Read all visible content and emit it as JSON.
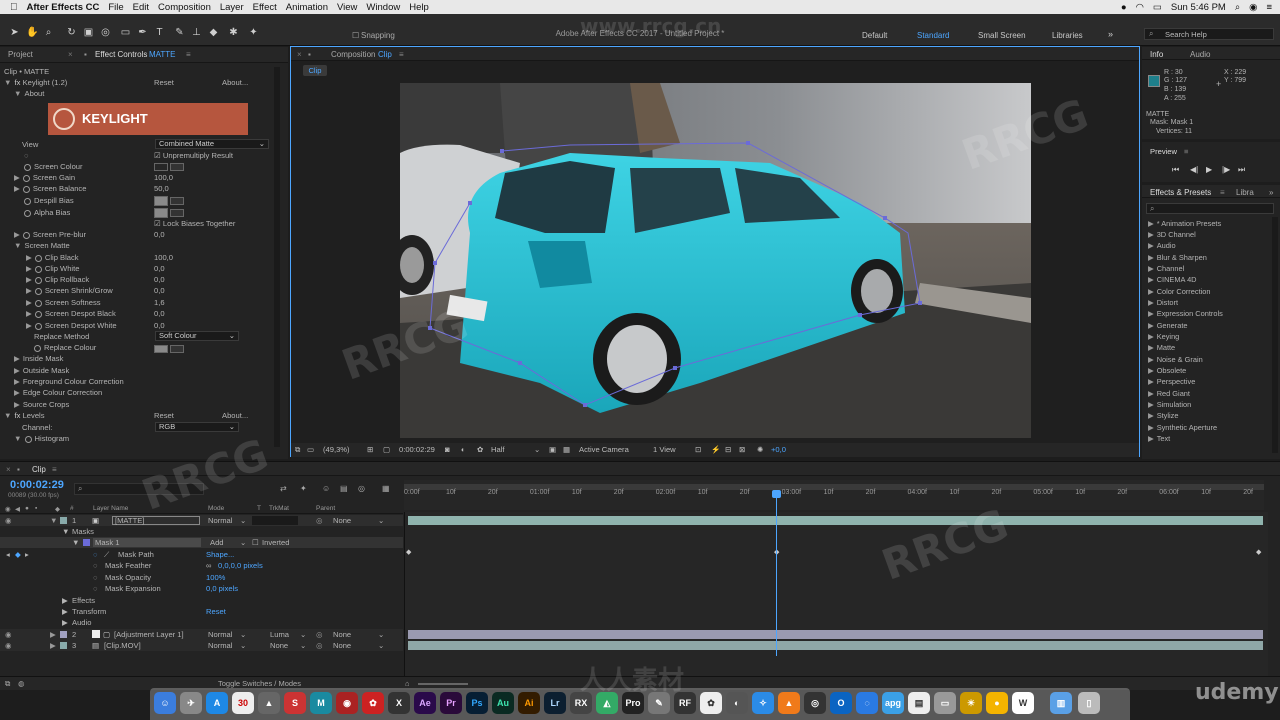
{
  "menubar": {
    "app": "After Effects CC",
    "items": [
      "File",
      "Edit",
      "Composition",
      "Layer",
      "Effect",
      "Animation",
      "View",
      "Window",
      "Help"
    ],
    "time": "Sun 5:46 PM"
  },
  "window_title": "Adobe After Effects CC 2017 - Untitled Project *",
  "toolbar": {
    "snapping": "Snapping",
    "workspaces": [
      "Default",
      "Standard",
      "Small Screen",
      "Libraries"
    ],
    "active_workspace": "Standard",
    "search_placeholder": "Search Help"
  },
  "effect_controls": {
    "tab_project": "Project",
    "tab_label": "Effect Controls",
    "tab_layer": "MATTE",
    "breadcrumb": "Clip • MATTE",
    "effect1": {
      "name": "Keylight (1.2)",
      "reset": "Reset",
      "about": "About..."
    },
    "about": "About",
    "logo_text": "KEYLIGHT",
    "view_label": "View",
    "view_value": "Combined Matte",
    "unpremultiply": "Unpremultiply Result",
    "screen_colour": "Screen Colour",
    "screen_gain": {
      "label": "Screen Gain",
      "value": "100,0"
    },
    "screen_balance": {
      "label": "Screen Balance",
      "value": "50,0"
    },
    "despill_bias": "Despill Bias",
    "alpha_bias": "Alpha Bias",
    "lock_biases": "Lock Biases Together",
    "screen_preblur": {
      "label": "Screen Pre-blur",
      "value": "0,0"
    },
    "screen_matte": "Screen Matte",
    "clip_black": {
      "label": "Clip Black",
      "value": "100,0"
    },
    "clip_white": {
      "label": "Clip White",
      "value": "0,0"
    },
    "clip_rollback": {
      "label": "Clip Rollback",
      "value": "0,0"
    },
    "shrink_grow": {
      "label": "Screen Shrink/Grow",
      "value": "0,0"
    },
    "softness": {
      "label": "Screen Softness",
      "value": "1,6"
    },
    "despot_black": {
      "label": "Screen Despot Black",
      "value": "0,0"
    },
    "despot_white": {
      "label": "Screen Despot White",
      "value": "0,0"
    },
    "replace_method": {
      "label": "Replace Method",
      "value": "Soft Colour"
    },
    "replace_colour": "Replace Colour",
    "inside_mask": "Inside Mask",
    "outside_mask": "Outside Mask",
    "fg_correction": "Foreground Colour Correction",
    "edge_correction": "Edge Colour Correction",
    "source_crops": "Source Crops",
    "effect2": {
      "name": "Levels",
      "reset": "Reset",
      "about": "About..."
    },
    "channel": {
      "label": "Channel:",
      "value": "RGB"
    },
    "histogram": "Histogram"
  },
  "composition": {
    "tab": "Composition",
    "tab_comp": "Clip",
    "subtab": "Clip",
    "zoom": "(49,3%)",
    "timecode": "0:00:02:29",
    "resolution": "Half",
    "camera": "Active Camera",
    "views": "1 View",
    "exposure": "+0,0"
  },
  "info": {
    "tab_info": "Info",
    "tab_audio": "Audio",
    "r": "R : 30",
    "g": "G : 127",
    "b": "B : 139",
    "a": "A : 255",
    "x": "X : 229",
    "y": "Y : 799",
    "layer": "MATTE",
    "mask": "Mask: Mask 1",
    "vertices": "Vertices: 11",
    "swatch_color": "#1e7f8b"
  },
  "preview": {
    "title": "Preview"
  },
  "effects_presets": {
    "tab": "Effects & Presets",
    "tab2": "Libra",
    "items": [
      "* Animation Presets",
      "3D Channel",
      "Audio",
      "Blur & Sharpen",
      "Channel",
      "CINEMA 4D",
      "Color Correction",
      "Distort",
      "Expression Controls",
      "Generate",
      "Keying",
      "Matte",
      "Noise & Grain",
      "Obsolete",
      "Perspective",
      "Red Giant",
      "Simulation",
      "Stylize",
      "Synthetic Aperture",
      "Text"
    ]
  },
  "timeline": {
    "tab": "Clip",
    "timecode": "0:00:02:29",
    "frames": "00089 (30.00 fps)",
    "col_layer_name": "Layer Name",
    "col_mode": "Mode",
    "col_t": "T",
    "col_trkmat": "TrkMat",
    "col_parent": "Parent",
    "ruler": [
      "0:00f",
      "10f",
      "20f",
      "01:00f",
      "10f",
      "20f",
      "02:00f",
      "10f",
      "20f",
      "03:00f",
      "10f",
      "20f",
      "04:00f",
      "10f",
      "20f",
      "05:00f",
      "10f",
      "20f",
      "06:00f",
      "10f",
      "20f"
    ],
    "layer1": {
      "num": "1",
      "name": "[MATTE]",
      "mode": "Normal",
      "parent": "None"
    },
    "masks": "Masks",
    "mask1": {
      "name": "Mask 1",
      "mode": "Add",
      "inverted": "Inverted"
    },
    "mask_path": {
      "label": "Mask Path",
      "value": "Shape..."
    },
    "mask_feather": {
      "label": "Mask Feather",
      "value": "0,0,0,0 pixels"
    },
    "mask_opacity": {
      "label": "Mask Opacity",
      "value": "100%"
    },
    "mask_expansion": {
      "label": "Mask Expansion",
      "value": "0,0 pixels"
    },
    "effects": "Effects",
    "transform": {
      "label": "Transform",
      "reset": "Reset"
    },
    "audio": "Audio",
    "layer2": {
      "num": "2",
      "name": "[Adjustment Layer 1]",
      "mode": "Normal",
      "trkmat": "Luma",
      "parent": "None"
    },
    "layer3": {
      "num": "3",
      "name": "[Clip.MOV]",
      "mode": "Normal",
      "trkmat": "None",
      "parent": "None"
    },
    "toggle": "Toggle Switches / Modes"
  },
  "dock": {
    "apps": [
      "Ae",
      "Pr",
      "Ps",
      "Au",
      "Ai",
      "Lr"
    ]
  },
  "watermarks": [
    "www.rrcg.cn",
    "RRCG",
    "人人素材",
    "udemy"
  ]
}
